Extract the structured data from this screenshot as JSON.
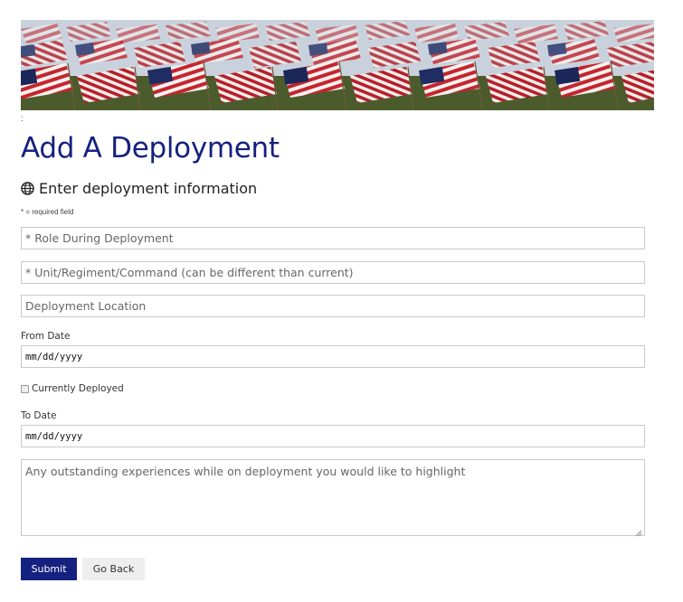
{
  "banner": {
    "alt": "field of american flags"
  },
  "colon_mark": ":",
  "page_title": "Add A Deployment",
  "section": {
    "icon": "globe-icon",
    "title": "Enter deployment information"
  },
  "required_note": "* = required field",
  "form": {
    "role_placeholder": "* Role During Deployment",
    "unit_placeholder": "* Unit/Regiment/Command (can be different than current)",
    "location_placeholder": "Deployment Location",
    "from_date_label": "From Date",
    "from_date_value": "mm/dd/yyyy",
    "currently_deployed_label": "Currently Deployed",
    "to_date_label": "To Date",
    "to_date_value": "mm/dd/yyyy",
    "experiences_placeholder": "Any outstanding experiences while on deployment you would like to highlight"
  },
  "buttons": {
    "submit": "Submit",
    "go_back": "Go Back"
  },
  "colors": {
    "accent": "#15217e",
    "field_border": "#c9c9c9"
  }
}
